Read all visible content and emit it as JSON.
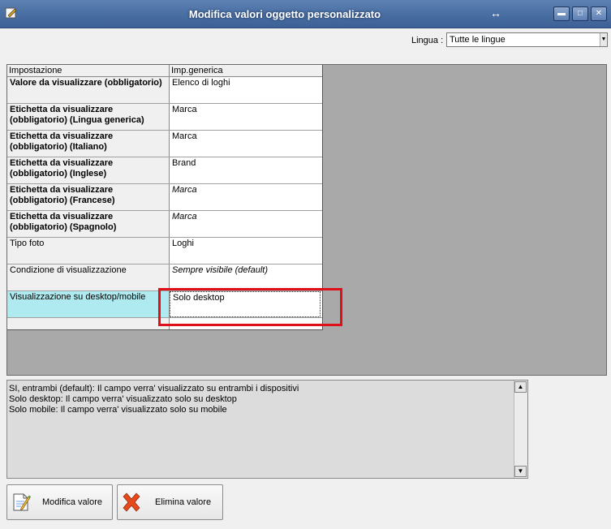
{
  "window": {
    "title": "Modifica valori oggetto personalizzato",
    "resize_glyph": "↔",
    "minimize": "▬",
    "maximize": "□",
    "close": "✕"
  },
  "language": {
    "label": "Lingua :",
    "value": "Tutte le lingue",
    "arrow": "▼"
  },
  "grid": {
    "headers": [
      "Impostazione",
      "Imp.generica"
    ],
    "rows": [
      {
        "setting": "Valore da visualizzare (obbligatorio)",
        "value": "Elenco di loghi"
      },
      {
        "setting": "Etichetta da visualizzare (obbligatorio) (Lingua generica)",
        "value": "Marca"
      },
      {
        "setting": "Etichetta da visualizzare (obbligatorio) (Italiano)",
        "value": "Marca"
      },
      {
        "setting": "Etichetta da visualizzare (obbligatorio) (Inglese)",
        "value": "Brand"
      },
      {
        "setting": "Etichetta da visualizzare (obbligatorio) (Francese)",
        "value": "Marca"
      },
      {
        "setting": "Etichetta da visualizzare (obbligatorio) (Spagnolo)",
        "value": "Marca"
      },
      {
        "setting": "Tipo foto",
        "value": "Loghi"
      },
      {
        "setting": "Condizione di visualizzazione",
        "value": "Sempre visibile (default)"
      },
      {
        "setting": "Visualizzazione su desktop/mobile",
        "value": "Solo desktop"
      }
    ]
  },
  "description": {
    "lines": [
      "SI, entrambi (default): Il campo verra' visualizzato su entrambi i dispositivi",
      "Solo desktop: Il campo verra' visualizzato solo su desktop",
      "Solo mobile: Il campo verra' visualizzato solo su mobile"
    ],
    "scroll_up": "▲",
    "scroll_down": "▼"
  },
  "buttons": {
    "edit": "Modifica valore",
    "delete": "Elimina valore"
  },
  "colors": {
    "selected_row": "#aeeaf0",
    "highlight": "#e0101a",
    "title_bar": "#4a6fa3"
  }
}
